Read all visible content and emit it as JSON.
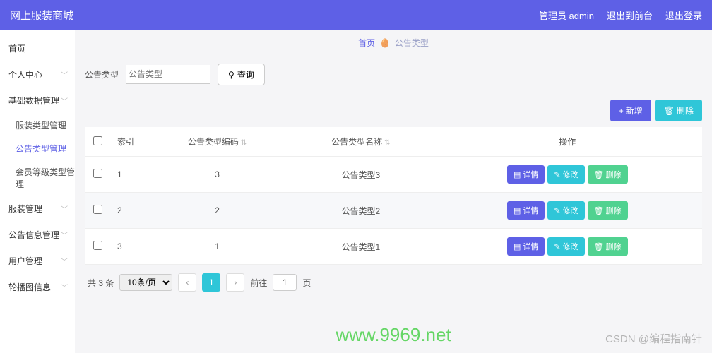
{
  "topbar": {
    "brand": "网上服装商城",
    "admin_label": "管理员 admin",
    "exit_front": "退出到前台",
    "logout": "退出登录"
  },
  "sidebar": {
    "items": [
      {
        "label": "首页",
        "expandable": false
      },
      {
        "label": "个人中心",
        "expandable": true
      },
      {
        "label": "基础数据管理",
        "expandable": true,
        "children": [
          {
            "label": "服装类型管理",
            "active": false
          },
          {
            "label": "公告类型管理",
            "active": true
          },
          {
            "label": "会员等级类型管理",
            "active": false
          }
        ]
      },
      {
        "label": "服装管理",
        "expandable": true
      },
      {
        "label": "公告信息管理",
        "expandable": true
      },
      {
        "label": "用户管理",
        "expandable": true
      },
      {
        "label": "轮播图信息",
        "expandable": true
      }
    ]
  },
  "crumb": {
    "home": "首页",
    "emoji": "🥚",
    "current": "公告类型"
  },
  "search": {
    "label": "公告类型",
    "placeholder": "公告类型",
    "button": "查询"
  },
  "toolbar": {
    "add": "新增",
    "del": "删除"
  },
  "table": {
    "headers": {
      "index": "索引",
      "code": "公告类型编码",
      "name": "公告类型名称",
      "ops": "操作"
    },
    "rows": [
      {
        "idx": "1",
        "code": "3",
        "name": "公告类型3"
      },
      {
        "idx": "2",
        "code": "2",
        "name": "公告类型2"
      },
      {
        "idx": "3",
        "code": "1",
        "name": "公告类型1"
      }
    ],
    "row_ops": {
      "detail": "详情",
      "edit": "修改",
      "del": "删除"
    }
  },
  "pager": {
    "total_prefix": "共 ",
    "total": "3",
    "total_suffix": " 条",
    "per_page": "10条/页",
    "current": "1",
    "goto_label": "前往",
    "goto_value": "1",
    "goto_suffix": "页"
  },
  "watermarks": {
    "url": "www.9969.net",
    "csdn": "CSDN @编程指南针"
  },
  "icons": {
    "search": "⚲",
    "plus": "+",
    "trash": "🗑",
    "doc": "▤",
    "edit": "✎"
  }
}
